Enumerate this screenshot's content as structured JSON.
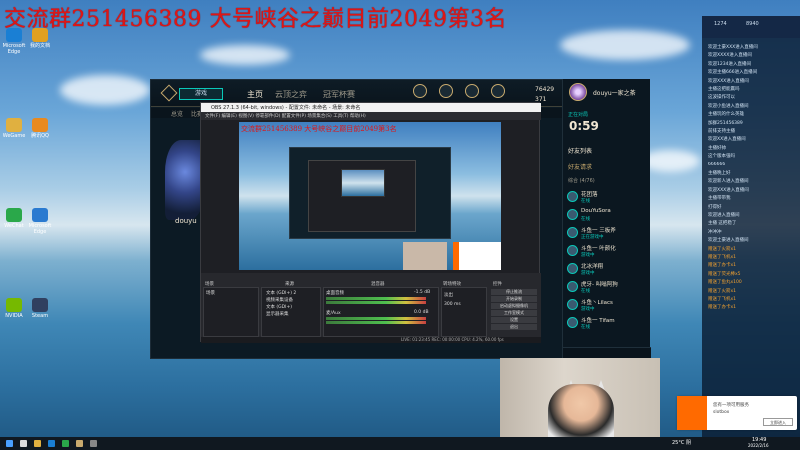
{
  "overlay": {
    "title": "交流群251456389 大号峡谷之巅目前2049第3名"
  },
  "desktop_icons": [
    {
      "label": "Microsoft Edge",
      "color": "#1a7fd4"
    },
    {
      "label": "我的文档",
      "color": "#e0a020"
    },
    {
      "label": "WeGame",
      "color": "#e0b040"
    },
    {
      "label": "腾讯QQ",
      "color": "#e88a20"
    },
    {
      "label": "WeChat",
      "color": "#2aa84a"
    },
    {
      "label": "Microsoft Edge",
      "color": "#2a7ad0"
    },
    {
      "label": "NVIDIA",
      "color": "#76b900"
    },
    {
      "label": "Steam",
      "color": "#304060"
    }
  ],
  "client": {
    "play_label": "游戏",
    "nav": [
      "主页",
      "云顶之弈",
      "冠军杯赛"
    ],
    "icons": [
      "合集",
      "商店",
      "战利品",
      "英雄"
    ],
    "currency_be": "76429",
    "currency_rp": "371",
    "sub_tabs": [
      "总览",
      "比赛",
      "英雄"
    ],
    "player_name": "douyu"
  },
  "friends": {
    "player": "douyu一家之茶",
    "tag": "正在对局",
    "time": "0:59",
    "header": "好友列表",
    "requests": "好友请求",
    "group": "综合 (4/76)",
    "items": [
      {
        "name": "花团落",
        "status": "在线"
      },
      {
        "name": "DouYuSora",
        "status": "在线"
      },
      {
        "name": "斗鱼一 三板斧",
        "status": "正在游戏中"
      },
      {
        "name": "斗鱼一 叶颜化",
        "status": "游戏中"
      },
      {
        "name": "北冰洋翔",
        "status": "游戏中"
      },
      {
        "name": "虎牙- 叫嗡阿狗",
        "status": "在线"
      },
      {
        "name": "斗鱼丶Lilacs",
        "status": "游戏中"
      },
      {
        "name": "斗鱼一 Tifam",
        "status": "在线"
      }
    ]
  },
  "obs": {
    "title": "OBS 27.1.3 (64-bit, windows) - 配置文件: 未命名 - 场景: 未命名",
    "menu": "文件(F)  编辑(E)  视图(V)  停靠部件(D)  配置文件(P)  场景集合(S)  工具(T)  帮助(H)",
    "preview_title": "交流群251456389 大号峡谷之巅目前2049第3名",
    "docks": {
      "scenes": "场景",
      "sources": "来源",
      "mixer": "混音器",
      "transitions": "转场特效",
      "controls": "控件"
    },
    "scene_items": [
      "场景"
    ],
    "source_items": [
      "文本 (GDI+) 2",
      "视频采集设备",
      "文本 (GDI+)",
      "显示器采集"
    ],
    "mixer_items": [
      "桌面音频",
      "麦/Aux"
    ],
    "mixer_levels": [
      "-1.5 dB",
      "0.0 dB"
    ],
    "transition": "淡出",
    "duration": "300 ms",
    "controls": [
      "停止推流",
      "开始录制",
      "启动虚拟摄像机",
      "工作室模式",
      "设置",
      "退出"
    ],
    "status": "LIVE: 01:23:45   REC: 00:00:00   CPU: 4.2%, 60.00 fps"
  },
  "chat": {
    "top": [
      "1274",
      "8940"
    ],
    "lines": [
      {
        "text": "欢迎土豪XXX进入直播间",
        "color": "#cfe0f0"
      },
      {
        "text": "欢迎XXXX进入直播间",
        "color": "#cfe0f0"
      },
      {
        "text": "欢迎1234进入直播间",
        "color": "#cfe0f0"
      },
      {
        "text": "欢迎主播666进入直播间",
        "color": "#cfe0f0"
      },
      {
        "text": "欢迎XXX进入直播间",
        "color": "#cfe0f0"
      },
      {
        "text": "主播这把能赢吗",
        "color": "#cfe0f0"
      },
      {
        "text": "这波操作可以",
        "color": "#cfe0f0"
      },
      {
        "text": "欢迎小鱼进入直播间",
        "color": "#cfe0f0"
      },
      {
        "text": "主播玩的什么英雄",
        "color": "#cfe0f0"
      },
      {
        "text": "加群251456389",
        "color": "#cfe0f0"
      },
      {
        "text": "前排支持主播",
        "color": "#cfe0f0"
      },
      {
        "text": "欢迎XX进入直播间",
        "color": "#cfe0f0"
      },
      {
        "text": "主播好帅",
        "color": "#cfe0f0"
      },
      {
        "text": "这个版本强吗",
        "color": "#cfe0f0"
      },
      {
        "text": "666666",
        "color": "#cfe0f0"
      },
      {
        "text": "主播晚上好",
        "color": "#cfe0f0"
      },
      {
        "text": "欢迎新人进入直播间",
        "color": "#cfe0f0"
      },
      {
        "text": "欢迎XXX进入直播间",
        "color": "#cfe0f0"
      },
      {
        "text": "主播带带我",
        "color": "#cfe0f0"
      },
      {
        "text": "打得好",
        "color": "#cfe0f0"
      },
      {
        "text": "欢迎进入直播间",
        "color": "#cfe0f0"
      },
      {
        "text": "主播 这把稳了",
        "color": "#cfe0f0"
      },
      {
        "text": "冲冲冲",
        "color": "#cfe0f0"
      },
      {
        "text": "欢迎土豪进入直播间",
        "color": "#cfe0f0"
      },
      {
        "text": "赠送了火箭x1",
        "color": "#f0a030"
      },
      {
        "text": "赠送了飞机x1",
        "color": "#f0a030"
      },
      {
        "text": "赠送了办卡x1",
        "color": "#f0a030"
      },
      {
        "text": "赠送了荧光棒x5",
        "color": "#f0a030"
      },
      {
        "text": "赠送了鱼丸x100",
        "color": "#f0a030"
      },
      {
        "text": "赠送了火箭x1",
        "color": "#f0a030"
      },
      {
        "text": "赠送了飞机x1",
        "color": "#f0a030"
      },
      {
        "text": "赠送了办卡x1",
        "color": "#f0a030"
      }
    ]
  },
  "ad": {
    "line1": "您有一项可用服务",
    "line2": "slotbox",
    "button": "立即进入"
  },
  "taskbar": {
    "weather": "25°C 阴",
    "time": "19:49",
    "date": "2022/2/16"
  }
}
